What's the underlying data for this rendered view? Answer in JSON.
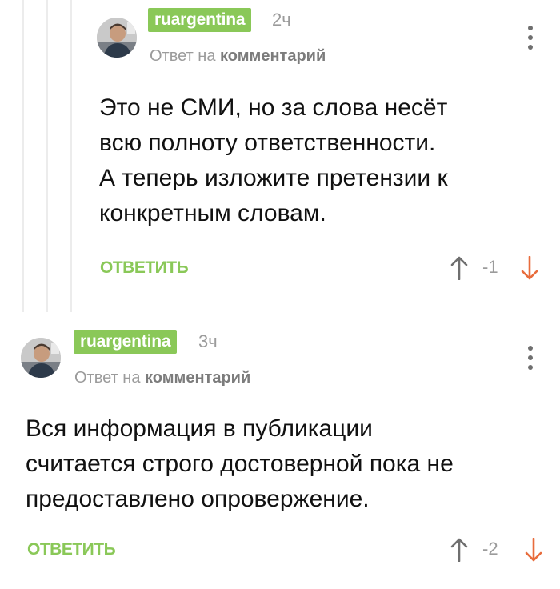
{
  "colors": {
    "accent_green": "#8ac858",
    "downvote_orange": "#e86c3c",
    "upvote_gray": "#6f6f6f",
    "meta_gray": "#9b9b9b"
  },
  "comments": [
    {
      "author": "ruargentina",
      "time": "2ч",
      "reply_prefix": "Ответ на",
      "reply_target": "комментарий",
      "text": "Это не СМИ, но за слова несёт\nвсю полноту ответственности.\nА теперь изложите претензии к\nконкретным словам.",
      "reply_label": "ОТВЕТИТЬ",
      "score": "-1",
      "avatar_icon": "user-photo-avatar",
      "upvote_icon": "arrow-up-icon",
      "downvote_icon": "arrow-down-icon",
      "menu_icon": "more-vertical-icon"
    },
    {
      "author": "ruargentina",
      "time": "3ч",
      "reply_prefix": "Ответ на",
      "reply_target": "комментарий",
      "text": "Вся информация в публикации\nсчитается строго достоверной пока не\nпредоставлено опровержение.",
      "reply_label": "ОТВЕТИТЬ",
      "score": "-2",
      "avatar_icon": "user-photo-avatar",
      "upvote_icon": "arrow-up-icon",
      "downvote_icon": "arrow-down-icon",
      "menu_icon": "more-vertical-icon"
    }
  ]
}
